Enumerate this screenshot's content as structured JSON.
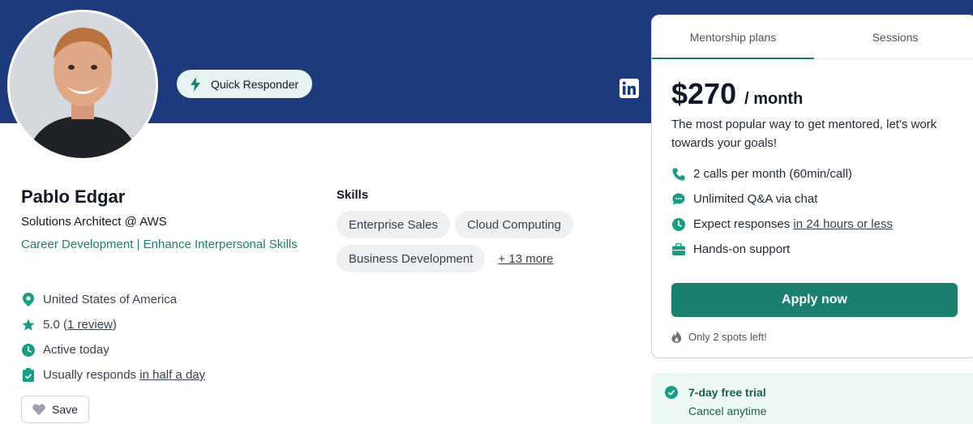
{
  "colors": {
    "banner": "#1d3a7c",
    "accent": "#1b7f6e",
    "chip_bg": "#eef0f2",
    "trial_bg": "#eef8f5"
  },
  "header": {
    "badge_label": "Quick Responder",
    "badge_icon": "bolt-icon",
    "social_icon": "linkedin-icon"
  },
  "profile": {
    "name": "Pablo Edgar",
    "role": "Solutions Architect @ AWS",
    "focus": "Career Development | Enhance Interpersonal Skills",
    "location": "United States of America",
    "rating": "5.0",
    "review_link": "1 review",
    "activity": "Active today",
    "response_prefix": "Usually responds",
    "response_link": "in half a day",
    "save_label": "Save"
  },
  "skills": {
    "title": "Skills",
    "items": [
      "Enterprise Sales",
      "Cloud Computing",
      "Business Development"
    ],
    "more_link": "+ 13 more"
  },
  "plan_card": {
    "tabs": [
      "Mentorship plans",
      "Sessions"
    ],
    "active_tab": "Mentorship plans",
    "price": "$270",
    "period": "/ month",
    "description": "The most popular way to get mentored, let's work towards your goals!",
    "features": {
      "calls": "2 calls per month (60min/call)",
      "chat": "Unlimited Q&A via chat",
      "response_prefix": "Expect responses",
      "response_link": "in 24 hours or less",
      "support": "Hands-on support"
    },
    "apply_label": "Apply now",
    "spots_text": "Only 2 spots left!"
  },
  "trial": {
    "title": "7-day free trial",
    "subtitle": "Cancel anytime"
  }
}
